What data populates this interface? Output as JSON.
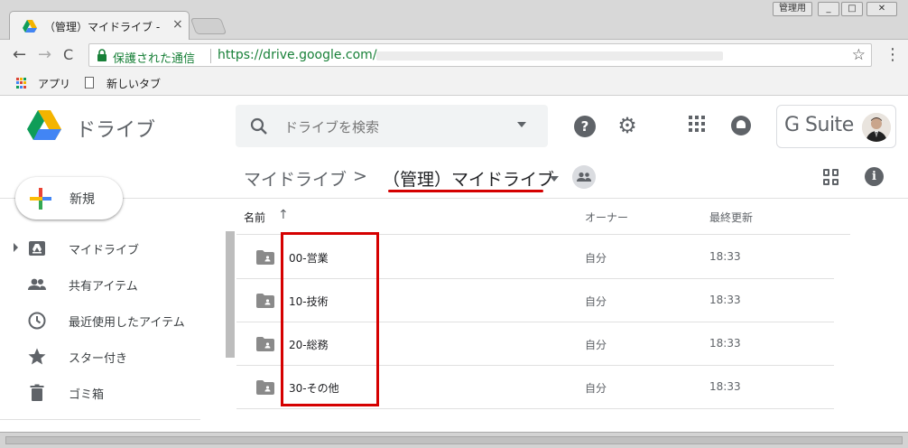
{
  "browser": {
    "tab_title": "（管理）マイドライブ -",
    "tab_close": "×",
    "window_badge": "管理用",
    "window_minimize": "_",
    "window_maximize": "□",
    "window_close": "✕",
    "nav_back": "←",
    "nav_forward": "→",
    "nav_reload": "C",
    "secure_label": "保護された通信",
    "url": "https://drive.google.com/",
    "star_glyph": "☆",
    "menu_glyph": "⋮",
    "bookmarks": {
      "apps_label": "アプリ",
      "newtab_label": "新しいタブ"
    }
  },
  "app": {
    "title": "ドライブ",
    "search_placeholder": "ドライブを検索",
    "help_glyph": "?",
    "gear_glyph": "⚙",
    "gsuite_label": "G Suite",
    "breadcrumb": {
      "root": "マイドライブ",
      "separator": ">",
      "current": "（管理）マイドライブ"
    },
    "info_glyph": "i",
    "new_button_label": "新規",
    "sidebar": {
      "items": [
        {
          "label": "マイドライブ",
          "icon": "drive-icon"
        },
        {
          "label": "共有アイテム",
          "icon": "people-icon"
        },
        {
          "label": "最近使用したアイテム",
          "icon": "clock-icon"
        },
        {
          "label": "スター付き",
          "icon": "star-icon"
        },
        {
          "label": "ゴミ箱",
          "icon": "trash-icon"
        }
      ]
    },
    "file_list": {
      "columns": {
        "name": "名前",
        "sort_arrow": "↑",
        "owner": "オーナー",
        "modified": "最終更新"
      },
      "rows": [
        {
          "name": "00-営業",
          "owner": "自分",
          "modified": "18:33"
        },
        {
          "name": "10-技術",
          "owner": "自分",
          "modified": "18:33"
        },
        {
          "name": "20-総務",
          "owner": "自分",
          "modified": "18:33"
        },
        {
          "name": "30-その他",
          "owner": "自分",
          "modified": "18:33"
        }
      ]
    }
  },
  "colors": {
    "secure_green": "#188038",
    "highlight_red": "#d50000",
    "icon_gray": "#5f6368",
    "drive_green": "#0f9d58",
    "drive_yellow": "#f4b400",
    "drive_blue": "#4285f4"
  }
}
